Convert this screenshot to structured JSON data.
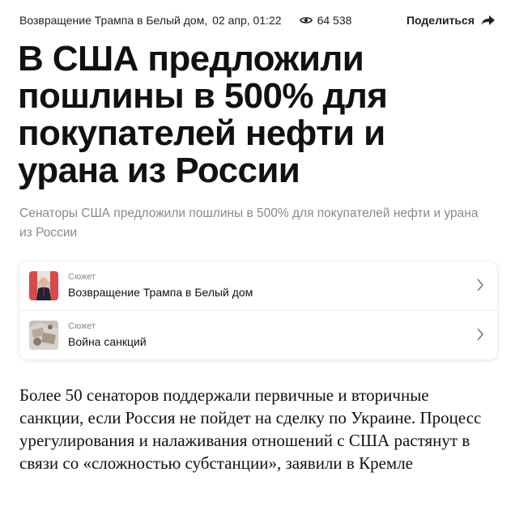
{
  "meta": {
    "story": "Возвращение Трампа в Белый дом",
    "datetime": "02 апр, 01:22",
    "views": "64 538",
    "share_label": "Поделиться",
    "icons": {
      "views": "eye-icon",
      "share": "share-arrow-icon"
    }
  },
  "article": {
    "title": "В США предложили пошлины в 500% для покупателей нефти и урана из России",
    "subtitle": "Сенаторы США предложили пошлины в 500% для покупателей нефти и урана из России",
    "lead": "Более 50 сенаторов поддержали первичные и вторичные санкции, если Россия не пойдет на сделку по Украине. Процесс урегулирования и налаживания отношений с США растянут в связи со «сложностью субстанции», заявили в Кремле"
  },
  "stories": [
    {
      "label": "Сюжет",
      "name": "Возвращение Трампа в Белый дом"
    },
    {
      "label": "Сюжет",
      "name": "Война санкций"
    }
  ],
  "colors": {
    "text": "#111111",
    "muted": "#8a8a8a",
    "card_border": "#ececec"
  }
}
